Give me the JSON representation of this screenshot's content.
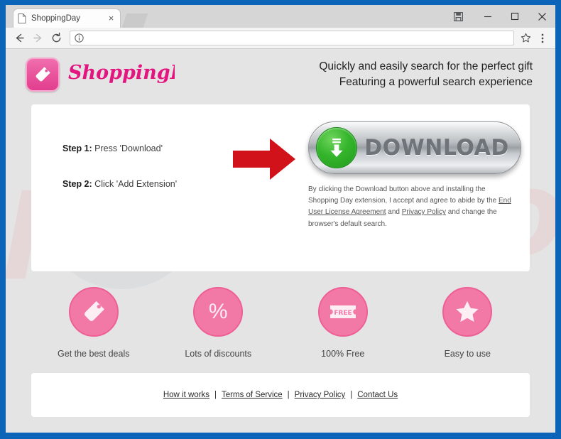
{
  "browser": {
    "tab_title": "ShoppingDay",
    "tab_close_glyph": "×",
    "url_value": "",
    "url_placeholder": "",
    "back_icon": "back-arrow-icon",
    "forward_icon": "forward-arrow-icon",
    "reload_icon": "reload-icon",
    "info_icon": "site-info-icon",
    "star_icon": "bookmark-star-icon",
    "menu_icon": "three-dot-menu-icon",
    "save_icon": "save-icon",
    "minimize_glyph": "–",
    "maximize_glyph": "□",
    "close_glyph": "✕",
    "frame_color": "#0b64b8"
  },
  "header": {
    "logo_text": "ShoppingDay!",
    "logo_mark_icon": "price-tag-icon",
    "tagline_line1": "Quickly and easily search for the perfect gift",
    "tagline_line2": "Featuring a powerful search experience",
    "brand_color": "#e23e8f"
  },
  "hero": {
    "step1_prefix": "Step 1:",
    "step1_text": "Press 'Download'",
    "step2_prefix": "Step 2:",
    "step2_text": "Click 'Add Extension'",
    "arrow_icon": "red-right-arrow-icon",
    "arrow_color": "#d2121a",
    "download_label": "DOWNLOAD",
    "download_icon": "download-arrow-icon",
    "download_icon_color": "#2fab27",
    "disclaimer_part1": "By clicking the Download button above and installing the Shopping Day extension, I accept and agree to abide by the ",
    "disclaimer_link1": "End User License Agreement",
    "disclaimer_mid": " and ",
    "disclaimer_link2": "Privacy Policy",
    "disclaimer_part2": " and change the browser's default search."
  },
  "features": [
    {
      "icon": "price-tag-icon",
      "label": "Get the best deals"
    },
    {
      "icon": "percent-icon",
      "label": "Lots of discounts",
      "glyph": "%"
    },
    {
      "icon": "free-ticket-icon",
      "label": "100% Free",
      "glyph": "FREE"
    },
    {
      "icon": "star-icon",
      "label": "Easy to use"
    }
  ],
  "footer": {
    "links": [
      {
        "label": "How it works"
      },
      {
        "label": "Terms of Service"
      },
      {
        "label": "Privacy Policy"
      },
      {
        "label": "Contact Us"
      }
    ],
    "separator": "|"
  },
  "watermark": {
    "text": "pcrisk.com",
    "color": "#ec96a0"
  }
}
